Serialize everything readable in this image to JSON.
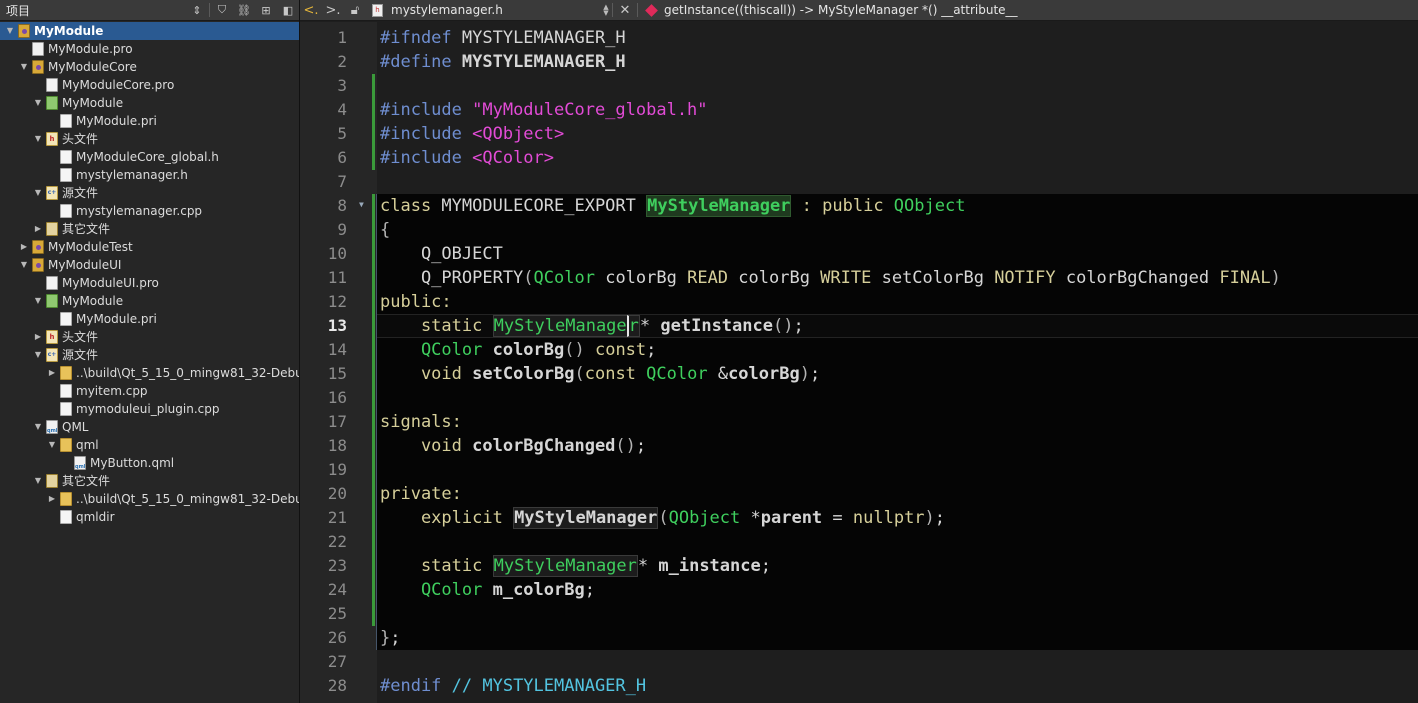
{
  "sidebar": {
    "title": "项目",
    "tree": [
      {
        "label": "MyModule",
        "level": 0,
        "expand": "open",
        "icon": "project-icon",
        "selected": true
      },
      {
        "label": "MyModule.pro",
        "level": 1,
        "expand": "none",
        "icon": "pro-file-icon"
      },
      {
        "label": "MyModuleCore",
        "level": 1,
        "expand": "open",
        "icon": "subproject-icon"
      },
      {
        "label": "MyModuleCore.pro",
        "level": 2,
        "expand": "none",
        "icon": "pro-file-icon"
      },
      {
        "label": "MyModule",
        "level": 2,
        "expand": "open",
        "icon": "pri-folder-icon"
      },
      {
        "label": "MyModule.pri",
        "level": 3,
        "expand": "none",
        "icon": "pri-file-icon"
      },
      {
        "label": "头文件",
        "level": 2,
        "expand": "open",
        "icon": "headers-folder-icon"
      },
      {
        "label": "MyModuleCore_global.h",
        "level": 3,
        "expand": "none",
        "icon": "header-file-icon"
      },
      {
        "label": "mystylemanager.h",
        "level": 3,
        "expand": "none",
        "icon": "header-file-icon"
      },
      {
        "label": "源文件",
        "level": 2,
        "expand": "open",
        "icon": "sources-folder-icon"
      },
      {
        "label": "mystylemanager.cpp",
        "level": 3,
        "expand": "none",
        "icon": "source-file-icon"
      },
      {
        "label": "其它文件",
        "level": 2,
        "expand": "closed",
        "icon": "other-files-folder-icon"
      },
      {
        "label": "MyModuleTest",
        "level": 1,
        "expand": "closed",
        "icon": "subproject-icon"
      },
      {
        "label": "MyModuleUI",
        "level": 1,
        "expand": "open",
        "icon": "subproject-icon"
      },
      {
        "label": "MyModuleUI.pro",
        "level": 2,
        "expand": "none",
        "icon": "pro-file-icon"
      },
      {
        "label": "MyModule",
        "level": 2,
        "expand": "open",
        "icon": "pri-folder-icon"
      },
      {
        "label": "MyModule.pri",
        "level": 3,
        "expand": "none",
        "icon": "pri-file-icon"
      },
      {
        "label": "头文件",
        "level": 2,
        "expand": "closed",
        "icon": "headers-folder-icon"
      },
      {
        "label": "源文件",
        "level": 2,
        "expand": "open",
        "icon": "sources-folder-icon"
      },
      {
        "label": "..\\build\\Qt_5_15_0_mingw81_32-Debu",
        "level": 3,
        "expand": "closed",
        "icon": "folder-icon"
      },
      {
        "label": "myitem.cpp",
        "level": 3,
        "expand": "none",
        "icon": "file-icon"
      },
      {
        "label": "mymoduleui_plugin.cpp",
        "level": 3,
        "expand": "none",
        "icon": "file-icon"
      },
      {
        "label": "QML",
        "level": 2,
        "expand": "open",
        "icon": "qml-folder-icon"
      },
      {
        "label": "qml",
        "level": 3,
        "expand": "open",
        "icon": "folder-icon"
      },
      {
        "label": "MyButton.qml",
        "level": 4,
        "expand": "none",
        "icon": "qml-file-icon"
      },
      {
        "label": "其它文件",
        "level": 2,
        "expand": "open",
        "icon": "other-files-folder-icon"
      },
      {
        "label": "..\\build\\Qt_5_15_0_mingw81_32-Debu",
        "level": 3,
        "expand": "closed",
        "icon": "folder-icon"
      },
      {
        "label": "qmldir",
        "level": 3,
        "expand": "none",
        "icon": "file-icon"
      }
    ]
  },
  "toolbar": {
    "file_name": "mystylemanager.h",
    "symbol": "getInstance((thiscall)) -> MyStyleManager *() __attribute__",
    "file_icon_glyph": "h"
  },
  "editor": {
    "current_line": 13,
    "modified_lines": [
      3,
      4,
      5,
      6,
      8,
      9,
      10,
      11,
      12,
      13,
      14,
      15,
      16,
      17,
      18,
      19,
      20,
      21,
      22,
      23,
      24,
      25
    ],
    "fold_lines": [
      8
    ],
    "lines": [
      [
        [
          "pp",
          "#ifndef"
        ],
        [
          "pt",
          " MYSTYLEMANAGER_H"
        ]
      ],
      [
        [
          "pp",
          "#define"
        ],
        [
          "pt b",
          " MYSTYLEMANAGER_H"
        ]
      ],
      [],
      [
        [
          "pp",
          "#include "
        ],
        [
          "str",
          "\"MyModuleCore_global.h\""
        ]
      ],
      [
        [
          "pp",
          "#include "
        ],
        [
          "str",
          "<QObject>"
        ]
      ],
      [
        [
          "pp",
          "#include "
        ],
        [
          "str",
          "<QColor>"
        ]
      ],
      [],
      [
        [
          "k",
          "class "
        ],
        [
          "m",
          "MYMODULECORE_EXPORT "
        ],
        [
          "cls-def",
          "MyStyleManager"
        ],
        [
          "m",
          " "
        ],
        [
          "k",
          ": public "
        ],
        [
          "ty",
          "QObject"
        ]
      ],
      [
        [
          "bk",
          "{"
        ]
      ],
      [
        [
          "m",
          "    Q_OBJECT"
        ]
      ],
      [
        [
          "m",
          "    Q_PROPERTY"
        ],
        [
          "bk",
          "("
        ],
        [
          "ty",
          "QColor"
        ],
        [
          "m",
          " colorBg "
        ],
        [
          "k",
          "READ"
        ],
        [
          "m",
          " colorBg "
        ],
        [
          "k",
          "WRITE"
        ],
        [
          "m",
          " setColorBg "
        ],
        [
          "k",
          "NOTIFY"
        ],
        [
          "m",
          " colorBgChanged "
        ],
        [
          "k",
          "FINAL"
        ],
        [
          "bk",
          ")"
        ]
      ],
      [
        [
          "k",
          "public:"
        ]
      ],
      [
        [
          "k",
          "    static "
        ],
        [
          "ty sym-box",
          "MyStyleManage"
        ],
        [
          "ty sym-box cursor",
          "r"
        ],
        [
          "m",
          "* "
        ],
        [
          "m b",
          "getInstance"
        ],
        [
          "bk",
          "()"
        ],
        [
          "m",
          ";"
        ]
      ],
      [
        [
          "ty",
          "    QColor "
        ],
        [
          "m b",
          "colorBg"
        ],
        [
          "bk",
          "() "
        ],
        [
          "k",
          "const"
        ],
        [
          "m",
          ";"
        ]
      ],
      [
        [
          "k",
          "    void "
        ],
        [
          "m b",
          "setColorBg"
        ],
        [
          "bk",
          "("
        ],
        [
          "k",
          "const "
        ],
        [
          "ty",
          "QColor "
        ],
        [
          "m",
          "&"
        ],
        [
          "m b",
          "colorBg"
        ],
        [
          "bk",
          ")"
        ],
        [
          "m",
          ";"
        ]
      ],
      [],
      [
        [
          "k",
          "signals:"
        ]
      ],
      [
        [
          "k",
          "    void "
        ],
        [
          "m b",
          "colorBgChanged"
        ],
        [
          "bk",
          "()"
        ],
        [
          "m",
          ";"
        ]
      ],
      [],
      [
        [
          "k",
          "private:"
        ]
      ],
      [
        [
          "k",
          "    explicit "
        ],
        [
          "m b sym-box",
          "MyStyleManager"
        ],
        [
          "bk",
          "("
        ],
        [
          "ty",
          "QObject "
        ],
        [
          "m",
          "*"
        ],
        [
          "m b",
          "parent"
        ],
        [
          "m",
          " = "
        ],
        [
          "k",
          "nullptr"
        ],
        [
          "bk",
          ")"
        ],
        [
          "m",
          ";"
        ]
      ],
      [],
      [
        [
          "k",
          "    static "
        ],
        [
          "ty sym-box",
          "MyStyleManager"
        ],
        [
          "m",
          "* "
        ],
        [
          "m b",
          "m_instance"
        ],
        [
          "m",
          ";"
        ]
      ],
      [
        [
          "ty",
          "    QColor "
        ],
        [
          "m b",
          "m_colorBg"
        ],
        [
          "m",
          ";"
        ]
      ],
      [],
      [
        [
          "bk",
          "}"
        ],
        [
          "m",
          ";"
        ]
      ],
      [],
      [
        [
          "pp",
          "#endif"
        ],
        [
          "cmt",
          " // MYSTYLEMANAGER_H"
        ]
      ]
    ]
  }
}
